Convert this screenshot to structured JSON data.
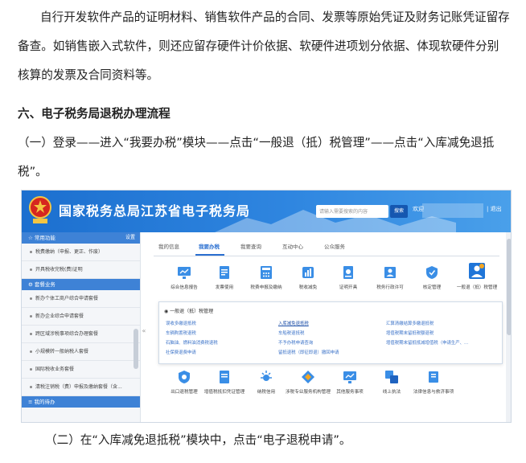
{
  "doc": {
    "para1": "自行开发软件产品的证明材料、销售软件产品的合同、发票等原始凭证及财务记账凭证留存备查。如销售嵌入式软件，则还应留存硬件计价依据、软硬件进项划分依据、体现软硬件分别核算的发票及合同资料等。",
    "heading6": "六、电子税务局退税办理流程",
    "para2": "（一）登录——进入“我要办税”模块——点击“一般退（抵）税管理”——点击“入库减免退抵税”。",
    "para3": "（二）在“入库减免退抵税”模块中，点击“电子退税申请”。"
  },
  "portal": {
    "title": "国家税务总局江苏省电子税务局",
    "search_placeholder": "请输入需要搜索的内容",
    "search_label": "搜索",
    "welcome": "欢迎",
    "logout": "| 退出",
    "sidebar": {
      "head1": "常用功能",
      "head1_more": "设置",
      "items1": [
        "税费缴纳（申报、更正、作废）",
        "开具税收完税(费)证明"
      ],
      "head2": "套餐业务",
      "items2": [
        "新办个体工商户综合申请套餐",
        "新办企业综合申请套餐",
        "跨区域涉税事项综合办理套餐",
        "小规模转一般纳税人套餐",
        "国际税收业务套餐",
        "清税注销税（费）申报及缴纳套餐（含..."
      ],
      "head3": "我的待办"
    },
    "tabs": [
      "我的信息",
      "我要办税",
      "我要查询",
      "互动中心",
      "公众服务"
    ],
    "services_row1": [
      "综合信息报告",
      "发票使用",
      "税费申报及缴纳",
      "税收减免",
      "证明开具",
      "税务行政许可",
      "核定管理",
      "一般退（抵）税管理"
    ],
    "popup": {
      "title": "一般退（抵）税管理",
      "col1": [
        "误收多缴退抵税",
        "车辆购置税退税",
        "石脑油、燃料油消费税退税",
        "社保费退费申请"
      ],
      "col2": [
        "入库减免退抵税",
        "车船税退抵税",
        "不予办税申请查询",
        "留抵退税（即征即退）撤回申请"
      ],
      "col3": [
        "汇算清缴结算多缴退抵税",
        "增值税期末留抵税额退税",
        "增值税期末留抵抵减增值税（申请生产、..."
      ]
    },
    "services_row2": [
      "出口退税管理",
      "增值税抵扣凭证管理",
      "纳税信用",
      "涉税专业服务机构管理",
      "其他服务事项",
      "线上执法",
      "法律信息与救济事项"
    ],
    "colors": {
      "brand_blue": "#1c6fcf",
      "link_blue": "#3a72c8",
      "sidebar_head": "#3e82d6"
    }
  }
}
